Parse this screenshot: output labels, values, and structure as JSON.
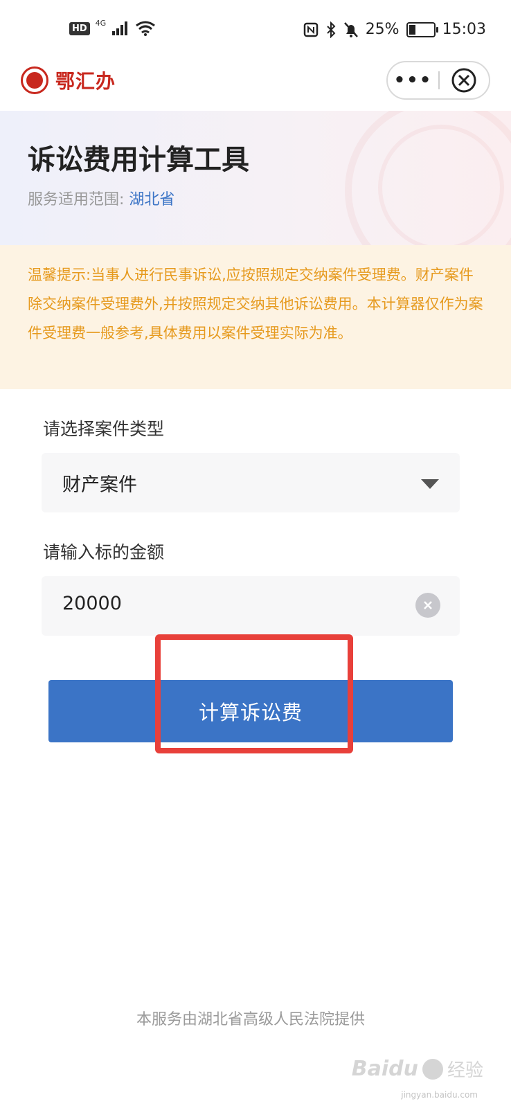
{
  "status_bar": {
    "hd": "HD",
    "network": "4G",
    "battery_percent_text": "25%",
    "battery_level": 0.25,
    "time": "15:03"
  },
  "header": {
    "brand": "鄂汇办",
    "more_label": "•••"
  },
  "hero": {
    "title": "诉讼费用计算工具",
    "scope_label": "服务适用范围:",
    "scope_value": "湖北省"
  },
  "tip": {
    "text": "温馨提示:当事人进行民事诉讼,应按照规定交纳案件受理费。财产案件除交纳案件受理费外,并按照规定交纳其他诉讼费用。本计算器仅作为案件受理费一般参考,具体费用以案件受理实际为准。"
  },
  "form": {
    "case_type_label": "请选择案件类型",
    "case_type_value": "财产案件",
    "amount_label": "请输入标的金额",
    "amount_value": "20000",
    "submit_label": "计算诉讼费"
  },
  "footer": {
    "text": "本服务由湖北省高级人民法院提供"
  },
  "watermark": {
    "brand": "Baidu",
    "cn": "经验",
    "url": "jingyan.baidu.com"
  },
  "colors": {
    "accent": "#3b74c6",
    "brand_red": "#c8281e",
    "tip_text": "#e69a1e",
    "tip_bg": "#fdf3e3",
    "highlight": "#e8403a"
  }
}
